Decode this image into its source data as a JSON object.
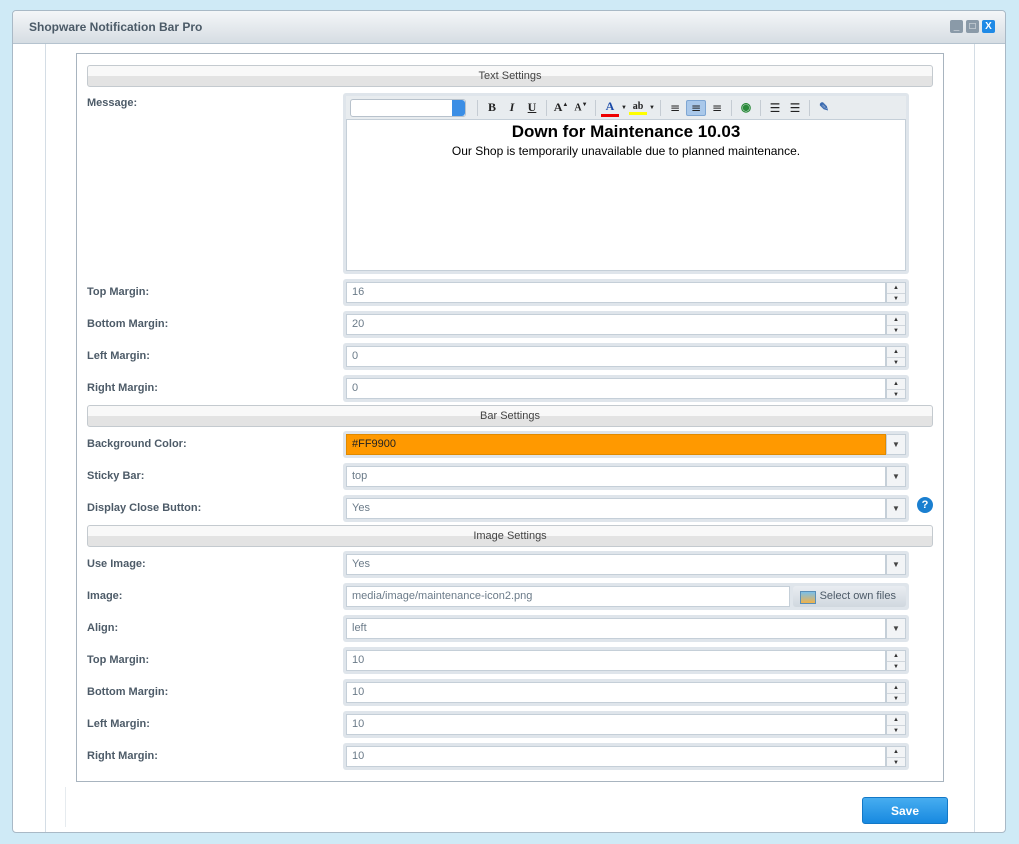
{
  "window": {
    "title": "Shopware Notification Bar Pro",
    "minimize": "_",
    "maximize": "□",
    "close": "X"
  },
  "sections": {
    "text": "Text Settings",
    "bar": "Bar Settings",
    "image": "Image Settings"
  },
  "message": {
    "label": "Message:",
    "font_select": "",
    "toolbar": [
      "bold",
      "italic",
      "underline",
      "grow-font",
      "shrink-font",
      "font-color",
      "highlight",
      "align-left",
      "align-center",
      "align-right",
      "link",
      "ordered-list",
      "unordered-list",
      "source-edit"
    ],
    "heading": "Down for Maintenance 10.03",
    "body": "Our Shop is temporarily unavailable due to planned maintenance."
  },
  "text_margins": [
    {
      "label": "Top Margin:",
      "value": "16"
    },
    {
      "label": "Bottom Margin:",
      "value": "20"
    },
    {
      "label": "Left Margin:",
      "value": "0"
    },
    {
      "label": "Right Margin:",
      "value": "0"
    }
  ],
  "bar": {
    "bg_label": "Background Color:",
    "bg_value": "#FF9900",
    "bg_color": "#FF9900",
    "sticky_label": "Sticky Bar:",
    "sticky_value": "top",
    "close_label": "Display Close Button:",
    "close_value": "Yes",
    "help": "?"
  },
  "image": {
    "use_label": "Use Image:",
    "use_value": "Yes",
    "image_label": "Image:",
    "image_value": "media/image/maintenance-icon2.png",
    "select_files": "Select own files",
    "align_label": "Align:",
    "align_value": "left"
  },
  "image_margins": [
    {
      "label": "Top Margin:",
      "value": "10"
    },
    {
      "label": "Bottom Margin:",
      "value": "10"
    },
    {
      "label": "Left Margin:",
      "value": "10"
    },
    {
      "label": "Right Margin:",
      "value": "10"
    }
  ],
  "save": "Save"
}
